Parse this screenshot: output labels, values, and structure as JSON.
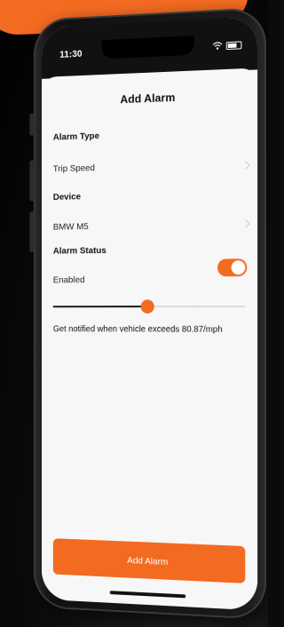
{
  "status": {
    "time": "11:30"
  },
  "header": {
    "title": "Add Alarm"
  },
  "alarm_type": {
    "label": "Alarm Type",
    "value": "Trip Speed"
  },
  "device": {
    "label": "Device",
    "value": "BMW M5"
  },
  "alarm_status": {
    "label": "Alarm Status",
    "value": "Enabled",
    "enabled": true
  },
  "speed_slider": {
    "fraction": 0.5
  },
  "notification": {
    "text": "Get notified when vehicle exceeds 80.87/mph"
  },
  "actions": {
    "add_label": "Add Alarm"
  },
  "colors": {
    "accent": "#f36b21",
    "background": "#f7f7f7",
    "text": "#111111"
  },
  "icons": {
    "chevron": "chevron-right-icon",
    "wifi": "wifi-icon",
    "battery": "battery-icon"
  }
}
